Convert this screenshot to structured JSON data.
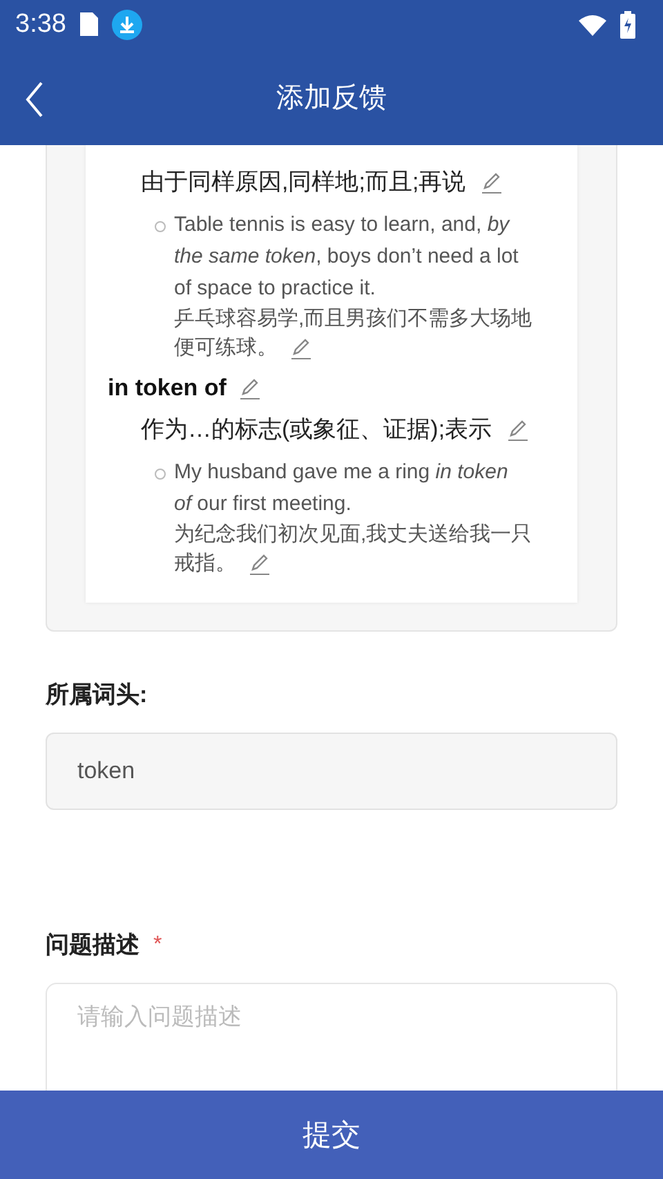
{
  "status_bar": {
    "time": "3:38"
  },
  "header": {
    "title": "添加反馈"
  },
  "entry_preview": {
    "items": [
      {
        "kind": "sense",
        "text": "由于同样原因,同样地;而且;再说"
      },
      {
        "kind": "example",
        "english": "Table tennis is easy to learn, and, *by the same token*, boys don’t need a lot of space to practice it.",
        "chinese": [
          "乒乓球容易学,而且男孩们不需多大场地",
          "便可练球。"
        ]
      },
      {
        "kind": "phrase",
        "text": "in token of"
      },
      {
        "kind": "sense",
        "text": "作为…的标志(或象征、证据);表示"
      },
      {
        "kind": "example",
        "english": "My husband gave me a ring *in token of* our first meeting.",
        "chinese": [
          "为纪念我们初次见面,我丈夫送给我一只",
          "戒指。"
        ]
      }
    ]
  },
  "headword": {
    "label": "所属词头:",
    "value": "token"
  },
  "description": {
    "label": "问题描述",
    "required_mark": "*",
    "placeholder": "请输入问题描述"
  },
  "submit_button": {
    "label": "提交"
  }
}
